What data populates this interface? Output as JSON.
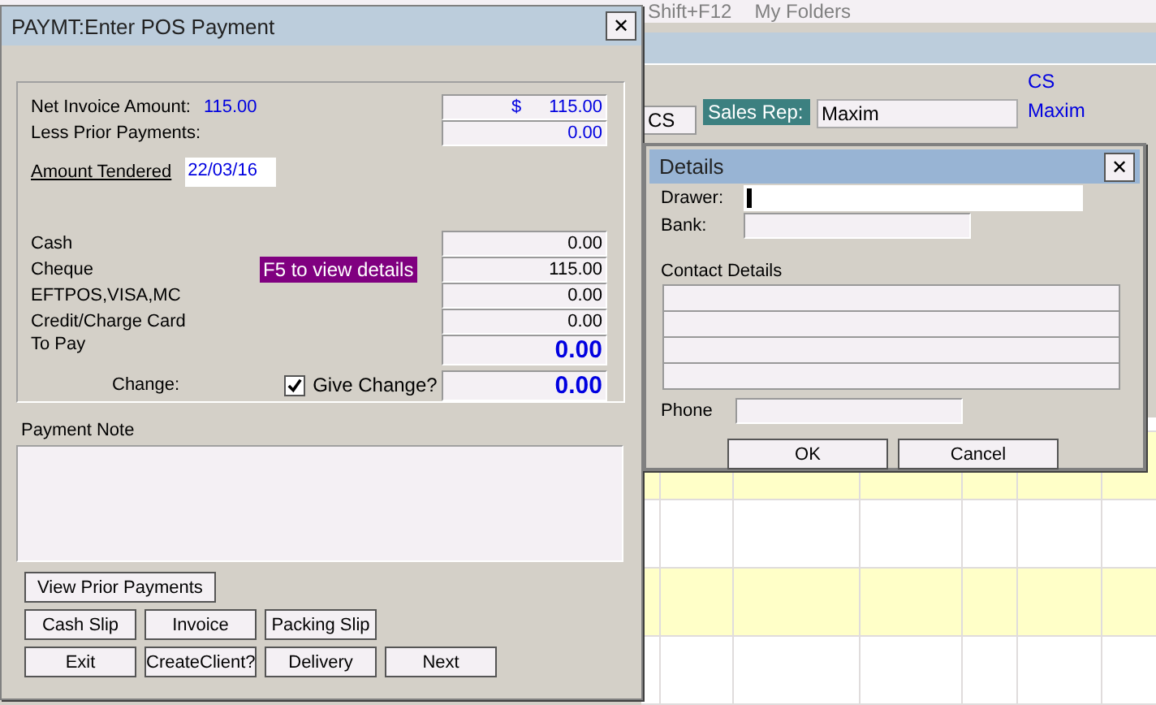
{
  "background_app": {
    "menu": [
      "Shift+F12",
      "My Folders"
    ],
    "code": "CS",
    "tab": "CS",
    "sales_rep_label": "Sales Rep:",
    "sales_rep": "Maxim",
    "rep_name": "Maxim",
    "grid_rows": [
      {
        "highlighted": false
      },
      {
        "highlighted": true
      },
      {
        "highlighted": false
      },
      {
        "highlighted": true
      },
      {
        "highlighted": false
      }
    ]
  },
  "payment_dialog": {
    "title": "PAYMT:Enter POS Payment",
    "close": "✕",
    "net_invoice": {
      "label": "Net Invoice Amount:",
      "value": "115.00",
      "currency": "$",
      "amount": "115.00"
    },
    "less_prior": {
      "label": "Less Prior Payments:",
      "amount": "0.00"
    },
    "amount_tendered": {
      "label": "Amount Tendered",
      "value": "22/03/16"
    },
    "payments": [
      {
        "label": "Cash",
        "amount": "0.00"
      },
      {
        "label": "Cheque",
        "amount": "115.00",
        "hint": "F5 to view details"
      },
      {
        "label": "EFTPOS,VISA,MC",
        "amount": "0.00"
      },
      {
        "label": "Credit/Charge Card",
        "amount": "0.00"
      }
    ],
    "to_pay": {
      "label": "To Pay",
      "amount": "0.00"
    },
    "change": {
      "label": "Change:",
      "give_change_label": "Give Change?",
      "give_change": true,
      "amount": "0.00"
    },
    "payment_note": {
      "label": "Payment Note"
    },
    "button_rows": [
      [
        "View Prior Payments"
      ],
      [
        "Cash Slip",
        "Invoice",
        "Packing Slip"
      ],
      [
        "Exit",
        "CreateClient?",
        "Delivery",
        "Next"
      ]
    ]
  },
  "details_dialog": {
    "title": "Details",
    "close": "✕",
    "drawer_label": "Drawer:",
    "drawer_focused": true,
    "bank_label": "Bank:",
    "contact_label": "Contact Details",
    "phone_label": "Phone",
    "buttons": [
      "OK",
      "Cancel"
    ]
  }
}
